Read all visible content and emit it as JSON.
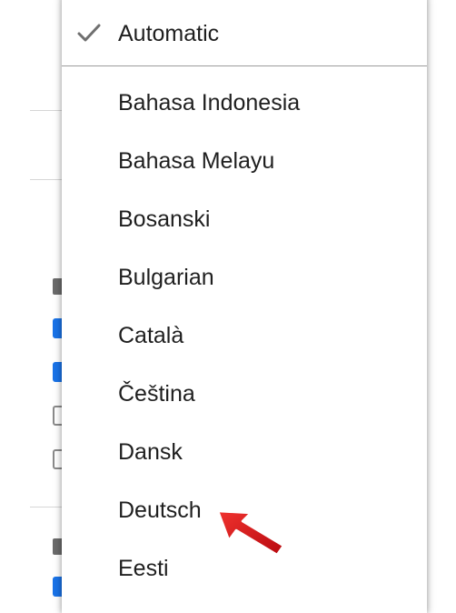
{
  "languages": {
    "selected": "Automatic",
    "automatic_label": "Automatic",
    "items": [
      "Bahasa Indonesia",
      "Bahasa Melayu",
      "Bosanski",
      "Bulgarian",
      "Català",
      "Čeština",
      "Dansk",
      "Deutsch",
      "Eesti"
    ]
  },
  "icons": {
    "selected_marker": "checkmark-icon",
    "pointer": "red-arrow-icon"
  },
  "colors": {
    "accent_blue": "#1a73e8",
    "arrow_red": "#d4151b",
    "text": "#1f1f1f",
    "check_gray": "#6f6f6f"
  }
}
